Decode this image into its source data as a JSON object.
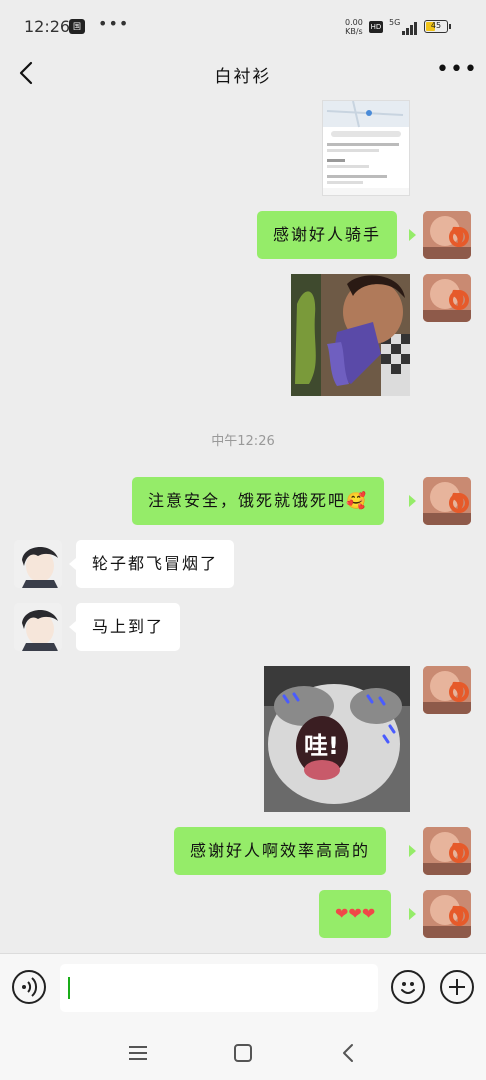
{
  "status_bar": {
    "time": "12:26",
    "app_badge": "国",
    "dots": "•••",
    "net_speed": "0.00",
    "net_unit": "KB/s",
    "hd": "HD",
    "network": "5G",
    "battery_level": "45",
    "battery_fraction": 0.45,
    "battery_color": "#f0c419"
  },
  "header": {
    "title": "白衬衫",
    "back_icon": "chevron-left-icon",
    "more_label": "•••"
  },
  "messages": [
    {
      "type": "image",
      "from": "me",
      "description": "map screenshot"
    },
    {
      "type": "text",
      "from": "me",
      "text": "感谢好人骑手"
    },
    {
      "type": "image",
      "from": "me",
      "description": "meme photo"
    },
    {
      "type": "timestamp",
      "text": "中午12:26"
    },
    {
      "type": "text",
      "from": "me",
      "text": "注意安全，饿死就饿死吧",
      "emoji": "🥰"
    },
    {
      "type": "text",
      "from": "other",
      "text": "轮子都飞冒烟了"
    },
    {
      "type": "text",
      "from": "other",
      "text": "马上到了"
    },
    {
      "type": "image",
      "from": "me",
      "caption": "哇!"
    },
    {
      "type": "text",
      "from": "me",
      "text": "感谢好人啊效率高高的"
    },
    {
      "type": "text",
      "from": "me",
      "text": "❤❤❤"
    }
  ],
  "input_bar": {
    "value": "",
    "voice_icon": "voice-icon",
    "emoji_icon": "emoji-icon",
    "plus_icon": "plus-icon"
  },
  "colors": {
    "bubble_out": "#95ec69",
    "bubble_in": "#ffffff",
    "background": "#ededed",
    "cursor": "#1aad19"
  }
}
